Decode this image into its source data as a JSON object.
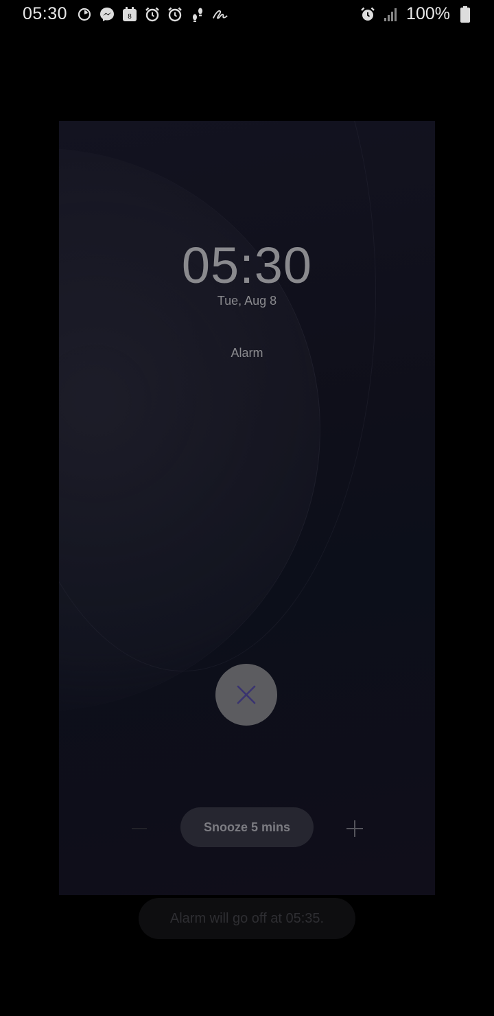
{
  "status_bar": {
    "time": "05:30",
    "left_icons": [
      "timer-icon",
      "messenger-icon",
      "calendar-icon",
      "alarm-icon",
      "alarm-icon",
      "walk-icon",
      "signature-icon"
    ],
    "calendar_day": "8",
    "battery_percent": "100%",
    "right_icons": [
      "alarm-icon",
      "signal-icon",
      "battery-icon"
    ]
  },
  "alarm": {
    "time": "05:30",
    "date": "Tue, Aug 8",
    "label": "Alarm",
    "dismiss_icon": "close-icon",
    "snooze_label": "Snooze 5 mins",
    "decrease_icon": "minus-icon",
    "increase_icon": "plus-icon"
  },
  "toast": {
    "message": "Alarm will go off at 05:35."
  },
  "colors": {
    "background": "#000000",
    "card": "#111119",
    "dismiss_button": "#5c5c60",
    "dismiss_x": "#3a3470",
    "snooze_button": "#262630",
    "text_dim": "#8a8a8e"
  }
}
